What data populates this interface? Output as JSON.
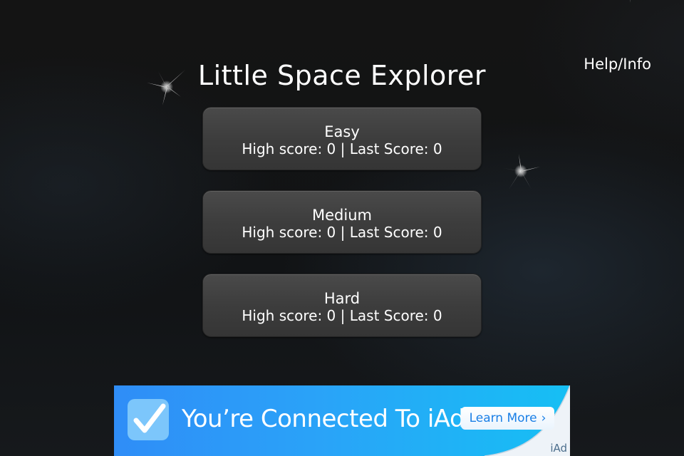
{
  "game": {
    "title": "Little Space Explorer",
    "help_label": "Help/Info"
  },
  "modes": [
    {
      "name": "Easy",
      "high_label": "High score:",
      "high": "0",
      "separator": "|",
      "last_label": "Last Score:",
      "last": "0"
    },
    {
      "name": "Medium",
      "high_label": "High score:",
      "high": "0",
      "separator": "|",
      "last_label": "Last Score:",
      "last": "0"
    },
    {
      "name": "Hard",
      "high_label": "High score:",
      "high": "0",
      "separator": "|",
      "last_label": "Last Score:",
      "last": "0"
    }
  ],
  "ad": {
    "headline": "You’re Connected To iAd",
    "cta_label": "Learn More",
    "cta_chevron": "›",
    "brand": "iAd",
    "colors": {
      "banner_start": "#2f8df7",
      "banner_end": "#16bff4",
      "cta_text": "#1a7fe6"
    }
  },
  "icons": [
    "sparkle-icon",
    "checkmark-icon",
    "chevron-right-icon"
  ]
}
